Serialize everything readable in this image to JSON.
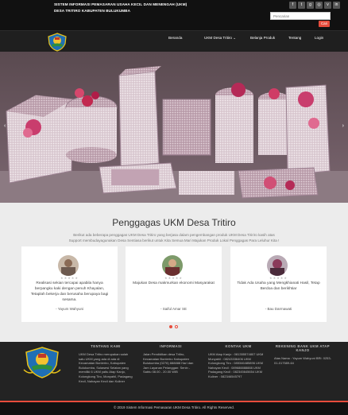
{
  "header": {
    "system_title_line1": "SISTEM INFORMASI PEMASARAN USAHA KECIL DAN MENENGAH (UKM)",
    "system_title_line2": "DESA TRITIRO KABUPATEN BULUKUMBA",
    "search_placeholder": "Pencarian",
    "search_button": "Cari",
    "social_icons": [
      "facebook-icon",
      "twitter-icon",
      "google-plus-icon",
      "instagram-icon",
      "vimeo-icon",
      "linkedin-icon"
    ]
  },
  "nav": {
    "items": [
      {
        "label": "Beranda"
      },
      {
        "label": "UKM Desa Tritiro ⌄"
      },
      {
        "label": "Belanja Produk"
      },
      {
        "label": "Tentang"
      },
      {
        "label": "Login"
      }
    ]
  },
  "hero": {
    "prev_icon": "‹",
    "next_icon": "›"
  },
  "testimonials": {
    "heading": "Penggagas UKM Desa Tritiro",
    "intro": "Berikut ada beberapa penggagas UKM Desa Tritiro yang berjasa dalam pengembangan produk UKM Desa Tiririro kasih atas Support membudayagunakan Desa Sentiasa berikut untuk Kita Semua Mari Majukan Produk Lokal Penggagas Para Leluhur Kita !",
    "stars": "★★★★★",
    "cards": [
      {
        "quote": "Realisasi sekian tercapai apabila hanya berpangku kaki dengan penuh Khayalan, Tetaplah bekerja dan berusaha berupaya bagi sesama.",
        "author": "- Yayum Wahyuni"
      },
      {
        "quote": "Majukan Desa makmurkan ekonomi Masyarakat",
        "author": "- Saiful Amar SE"
      },
      {
        "quote": "Tidak Ada Usaha yang Mengkhianati Hasil, Tetap Berdoa dan berikhtiar",
        "author": "- Bau Darmawati"
      }
    ]
  },
  "footer": {
    "col1": {
      "title": "TENTANG KAMI",
      "text": "UKM Desa Tritiro merupakan salah satu UKM yang ada di ada di Kecamatan Bonteriro, Kabupaten Bulukumba, Sulawesi Selatan yang memiliki 6 UKM yaitu Atap Kanjo, Kolongkong Tiro, Monyahil, Padagang Kecil, Nahayan Kecil dan Kuliner"
    },
    "col2": {
      "title": "INFORMASI",
      "text": "Jalan Pendidikan desa Tritiro, Kecamatan Bonteriro Kabupaten Bulukumba (0276) 888888 Hari dan Jam Layanan Pelanggan: Senin - Sabtu 08.00 - 20.00 WIB"
    },
    "col3": {
      "title": "KONTAK UKM",
      "text": "UKM Atap Kanjo : 081355574807 UKM Monyahil : 08243336406 UKM Kolongkong Tiro : 085346485896 UKM Nahayan Kecil : 089688888888 UKM Padagang Kecil : 082345645654 UKM Kuliner : 082346545797"
    },
    "col4": {
      "title": "REKENING BANK UKM ATAP KANJO",
      "text": "Atas Nama : Yayum Wahyuni BRI: 0253-01-017589-64"
    }
  },
  "copyright": "© 2019 Sistem Informasi Pemasaran UKM Desa Tritiro. All Rights Reserved."
}
